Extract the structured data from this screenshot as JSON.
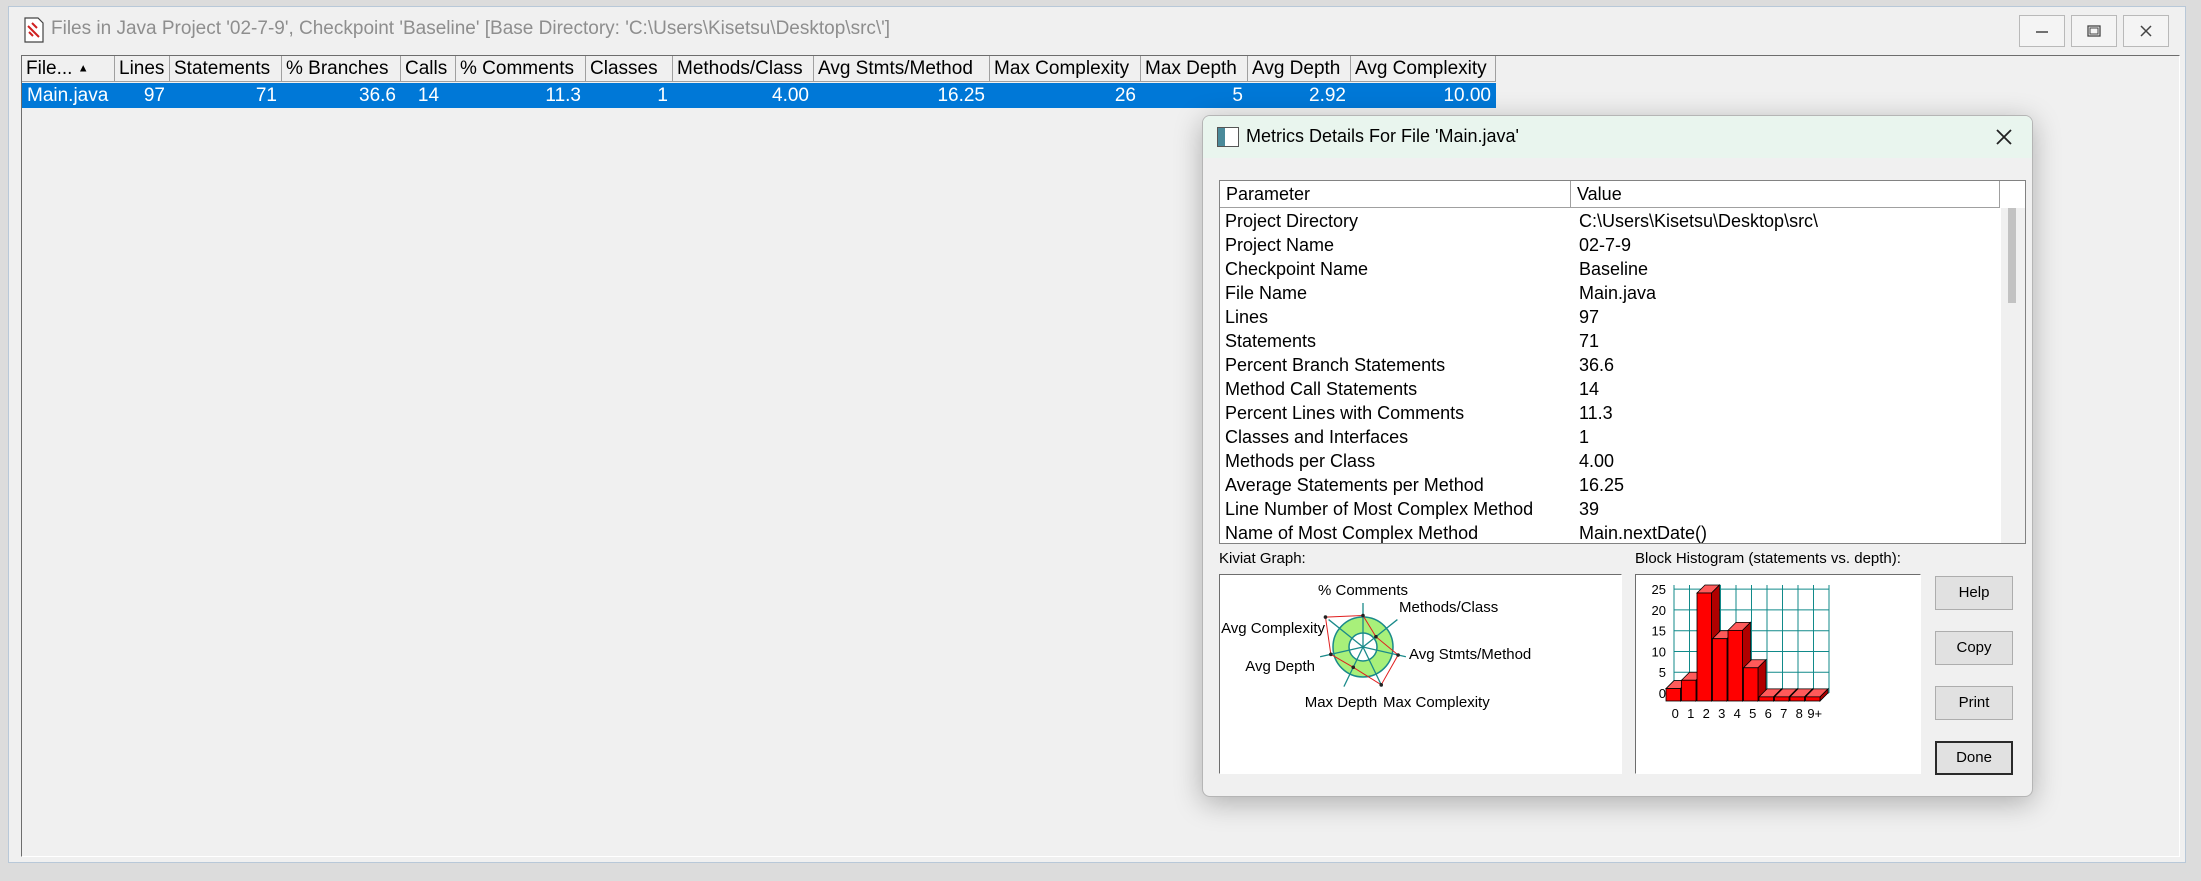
{
  "window": {
    "title": "Files in Java Project '02-7-9', Checkpoint 'Baseline'  [Base Directory: 'C:\\Users\\Kisetsu\\Desktop\\src\\']"
  },
  "table": {
    "headers": [
      "File...",
      "Lines",
      "Statements",
      "% Branches",
      "Calls",
      "% Comments",
      "Classes",
      "Methods/Class",
      "Avg Stmts/Method",
      "Max Complexity",
      "Max Depth",
      "Avg Depth",
      "Avg Complexity"
    ],
    "rows": [
      [
        "Main.java",
        "97",
        "71",
        "36.6",
        "14",
        "11.3",
        "1",
        "4.00",
        "16.25",
        "26",
        "5",
        "2.92",
        "10.00"
      ]
    ]
  },
  "dialog": {
    "title": "Metrics Details For File 'Main.java'",
    "list_headers": [
      "Parameter",
      "Value"
    ],
    "details": [
      [
        "Project Directory",
        "C:\\Users\\Kisetsu\\Desktop\\src\\"
      ],
      [
        "Project Name",
        "02-7-9"
      ],
      [
        "Checkpoint Name",
        "Baseline"
      ],
      [
        "File Name",
        "Main.java"
      ],
      [
        "Lines",
        "97"
      ],
      [
        "Statements",
        "71"
      ],
      [
        "Percent Branch Statements",
        "36.6"
      ],
      [
        "Method Call Statements",
        "14"
      ],
      [
        "Percent Lines with Comments",
        "11.3"
      ],
      [
        "Classes and Interfaces",
        "1"
      ],
      [
        "Methods per Class",
        "4.00"
      ],
      [
        "Average Statements per Method",
        "16.25"
      ],
      [
        "Line Number of Most Complex Method",
        "39"
      ],
      [
        "Name of Most Complex Method",
        "Main.nextDate()"
      ]
    ],
    "kiviat_label": "Kiviat Graph:",
    "histogram_label": "Block Histogram (statements vs. depth):",
    "buttons": {
      "help": "Help",
      "copy": "Copy",
      "print": "Print",
      "done": "Done"
    }
  },
  "chart_data": [
    {
      "type": "radar",
      "axes": [
        "% Comments",
        "Methods/Class",
        "Avg Stmts/Method",
        "Max Complexity",
        "Max Depth",
        "Avg Depth",
        "Avg Complexity"
      ],
      "values_relative": [
        1.05,
        0.55,
        1.2,
        1.4,
        0.75,
        1.1,
        1.6
      ],
      "colors": {
        "outer_band": "#a8f07a",
        "inner": "#ffffff",
        "axes": "#1a8a8a",
        "polygon": "#e02020"
      }
    },
    {
      "type": "bar",
      "categories": [
        "0",
        "1",
        "2",
        "3",
        "4",
        "5",
        "6",
        "7",
        "8",
        "9+"
      ],
      "values": [
        3,
        5,
        26,
        15,
        17,
        8,
        1,
        1,
        1,
        1
      ],
      "ylim": [
        0,
        26
      ],
      "yticks": [
        0,
        5,
        10,
        15,
        20,
        25
      ],
      "colors": {
        "bar": "#ff0000",
        "grid": "#118a8a"
      }
    }
  ]
}
